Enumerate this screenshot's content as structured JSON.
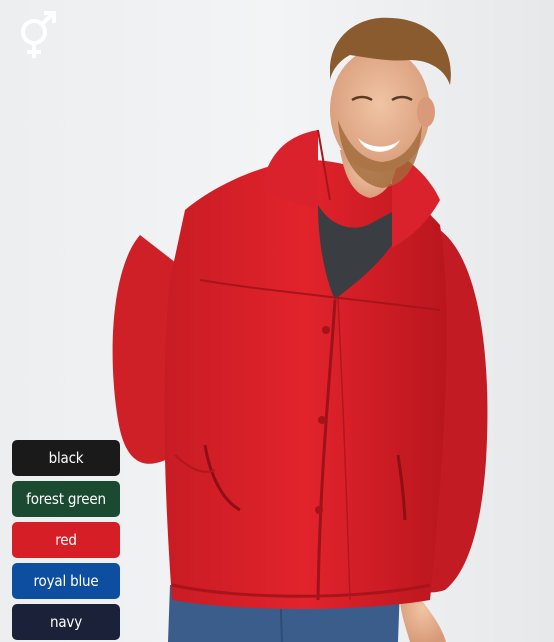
{
  "product": {
    "unisex_icon": "male-female-symbol-icon",
    "image_subject": "jacket",
    "colors": [
      {
        "label": "black",
        "hex": "#1a1a1a"
      },
      {
        "label": "forest green",
        "hex": "#1b4a33"
      },
      {
        "label": "red",
        "hex": "#d51e26"
      },
      {
        "label": "royal blue",
        "hex": "#0e4ea0"
      },
      {
        "label": "navy",
        "hex": "#1b2138"
      }
    ]
  }
}
